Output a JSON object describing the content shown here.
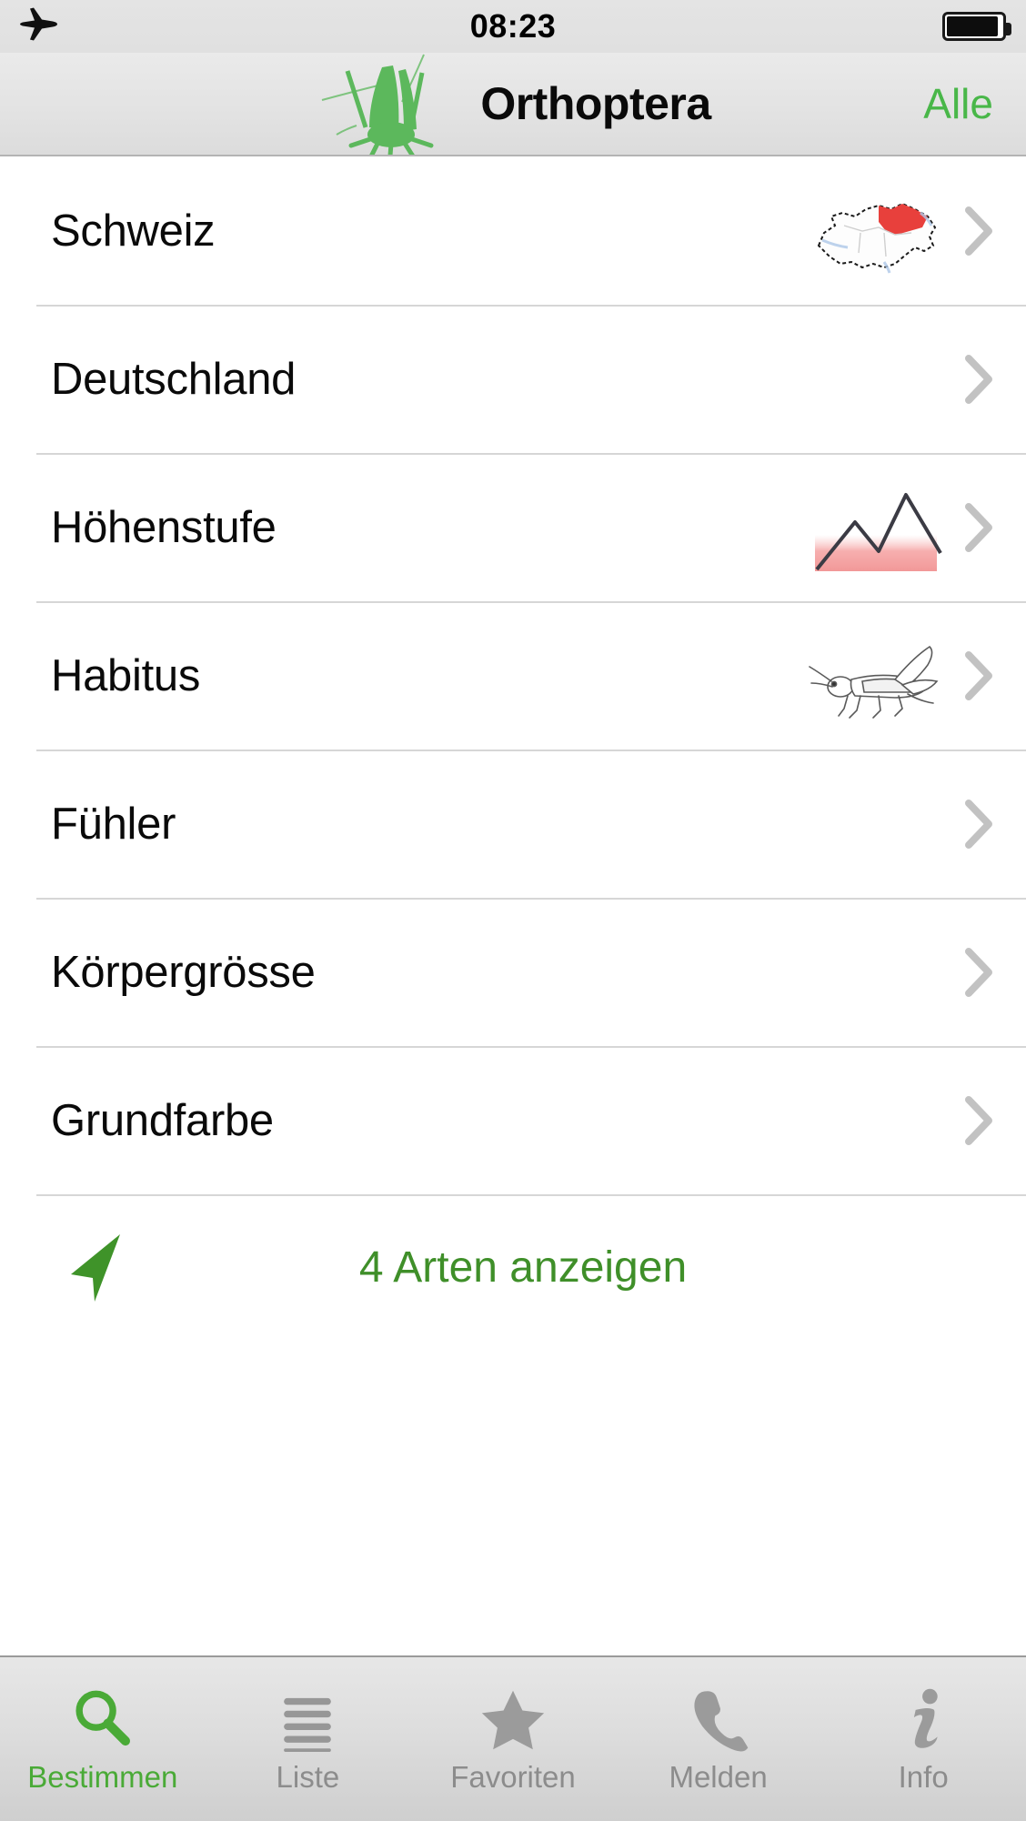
{
  "status_bar": {
    "airplane_icon": "airplane-icon",
    "time": "08:23",
    "battery_icon": "battery-icon",
    "battery_level_percent": 88
  },
  "nav_bar": {
    "logo_icon": "grasshopper-logo-icon",
    "title": "Orthoptera",
    "right_action": "Alle"
  },
  "list": {
    "rows": [
      {
        "label": "Schweiz",
        "thumb": "switzerland-map-icon",
        "chevron": "chevron-right-icon"
      },
      {
        "label": "Deutschland",
        "thumb": null,
        "chevron": "chevron-right-icon"
      },
      {
        "label": "Höhenstufe",
        "thumb": "mountain-altitude-icon",
        "chevron": "chevron-right-icon"
      },
      {
        "label": "Habitus",
        "thumb": "grasshopper-habitus-icon",
        "chevron": "chevron-right-icon"
      },
      {
        "label": "Fühler",
        "thumb": null,
        "chevron": "chevron-right-icon"
      },
      {
        "label": "Körpergrösse",
        "thumb": null,
        "chevron": "chevron-right-icon"
      },
      {
        "label": "Grundfarbe",
        "thumb": null,
        "chevron": "chevron-right-icon"
      }
    ]
  },
  "action_row": {
    "arrow_icon": "navigation-arrow-icon",
    "text": "4 Arten anzeigen"
  },
  "tab_bar": {
    "tabs": [
      {
        "label": "Bestimmen",
        "icon": "search-icon",
        "active": true
      },
      {
        "label": "Liste",
        "icon": "list-icon",
        "active": false
      },
      {
        "label": "Favoriten",
        "icon": "star-icon",
        "active": false
      },
      {
        "label": "Melden",
        "icon": "phone-icon",
        "active": false
      },
      {
        "label": "Info",
        "icon": "info-icon",
        "active": false
      }
    ]
  },
  "colors": {
    "accent_green": "#4aaa37",
    "action_green": "#3f8f29",
    "alle_green": "#49b749",
    "map_red": "#e8403c",
    "altitude_pink": "#f4a0a0",
    "inactive_gray": "#8c8c8c"
  }
}
